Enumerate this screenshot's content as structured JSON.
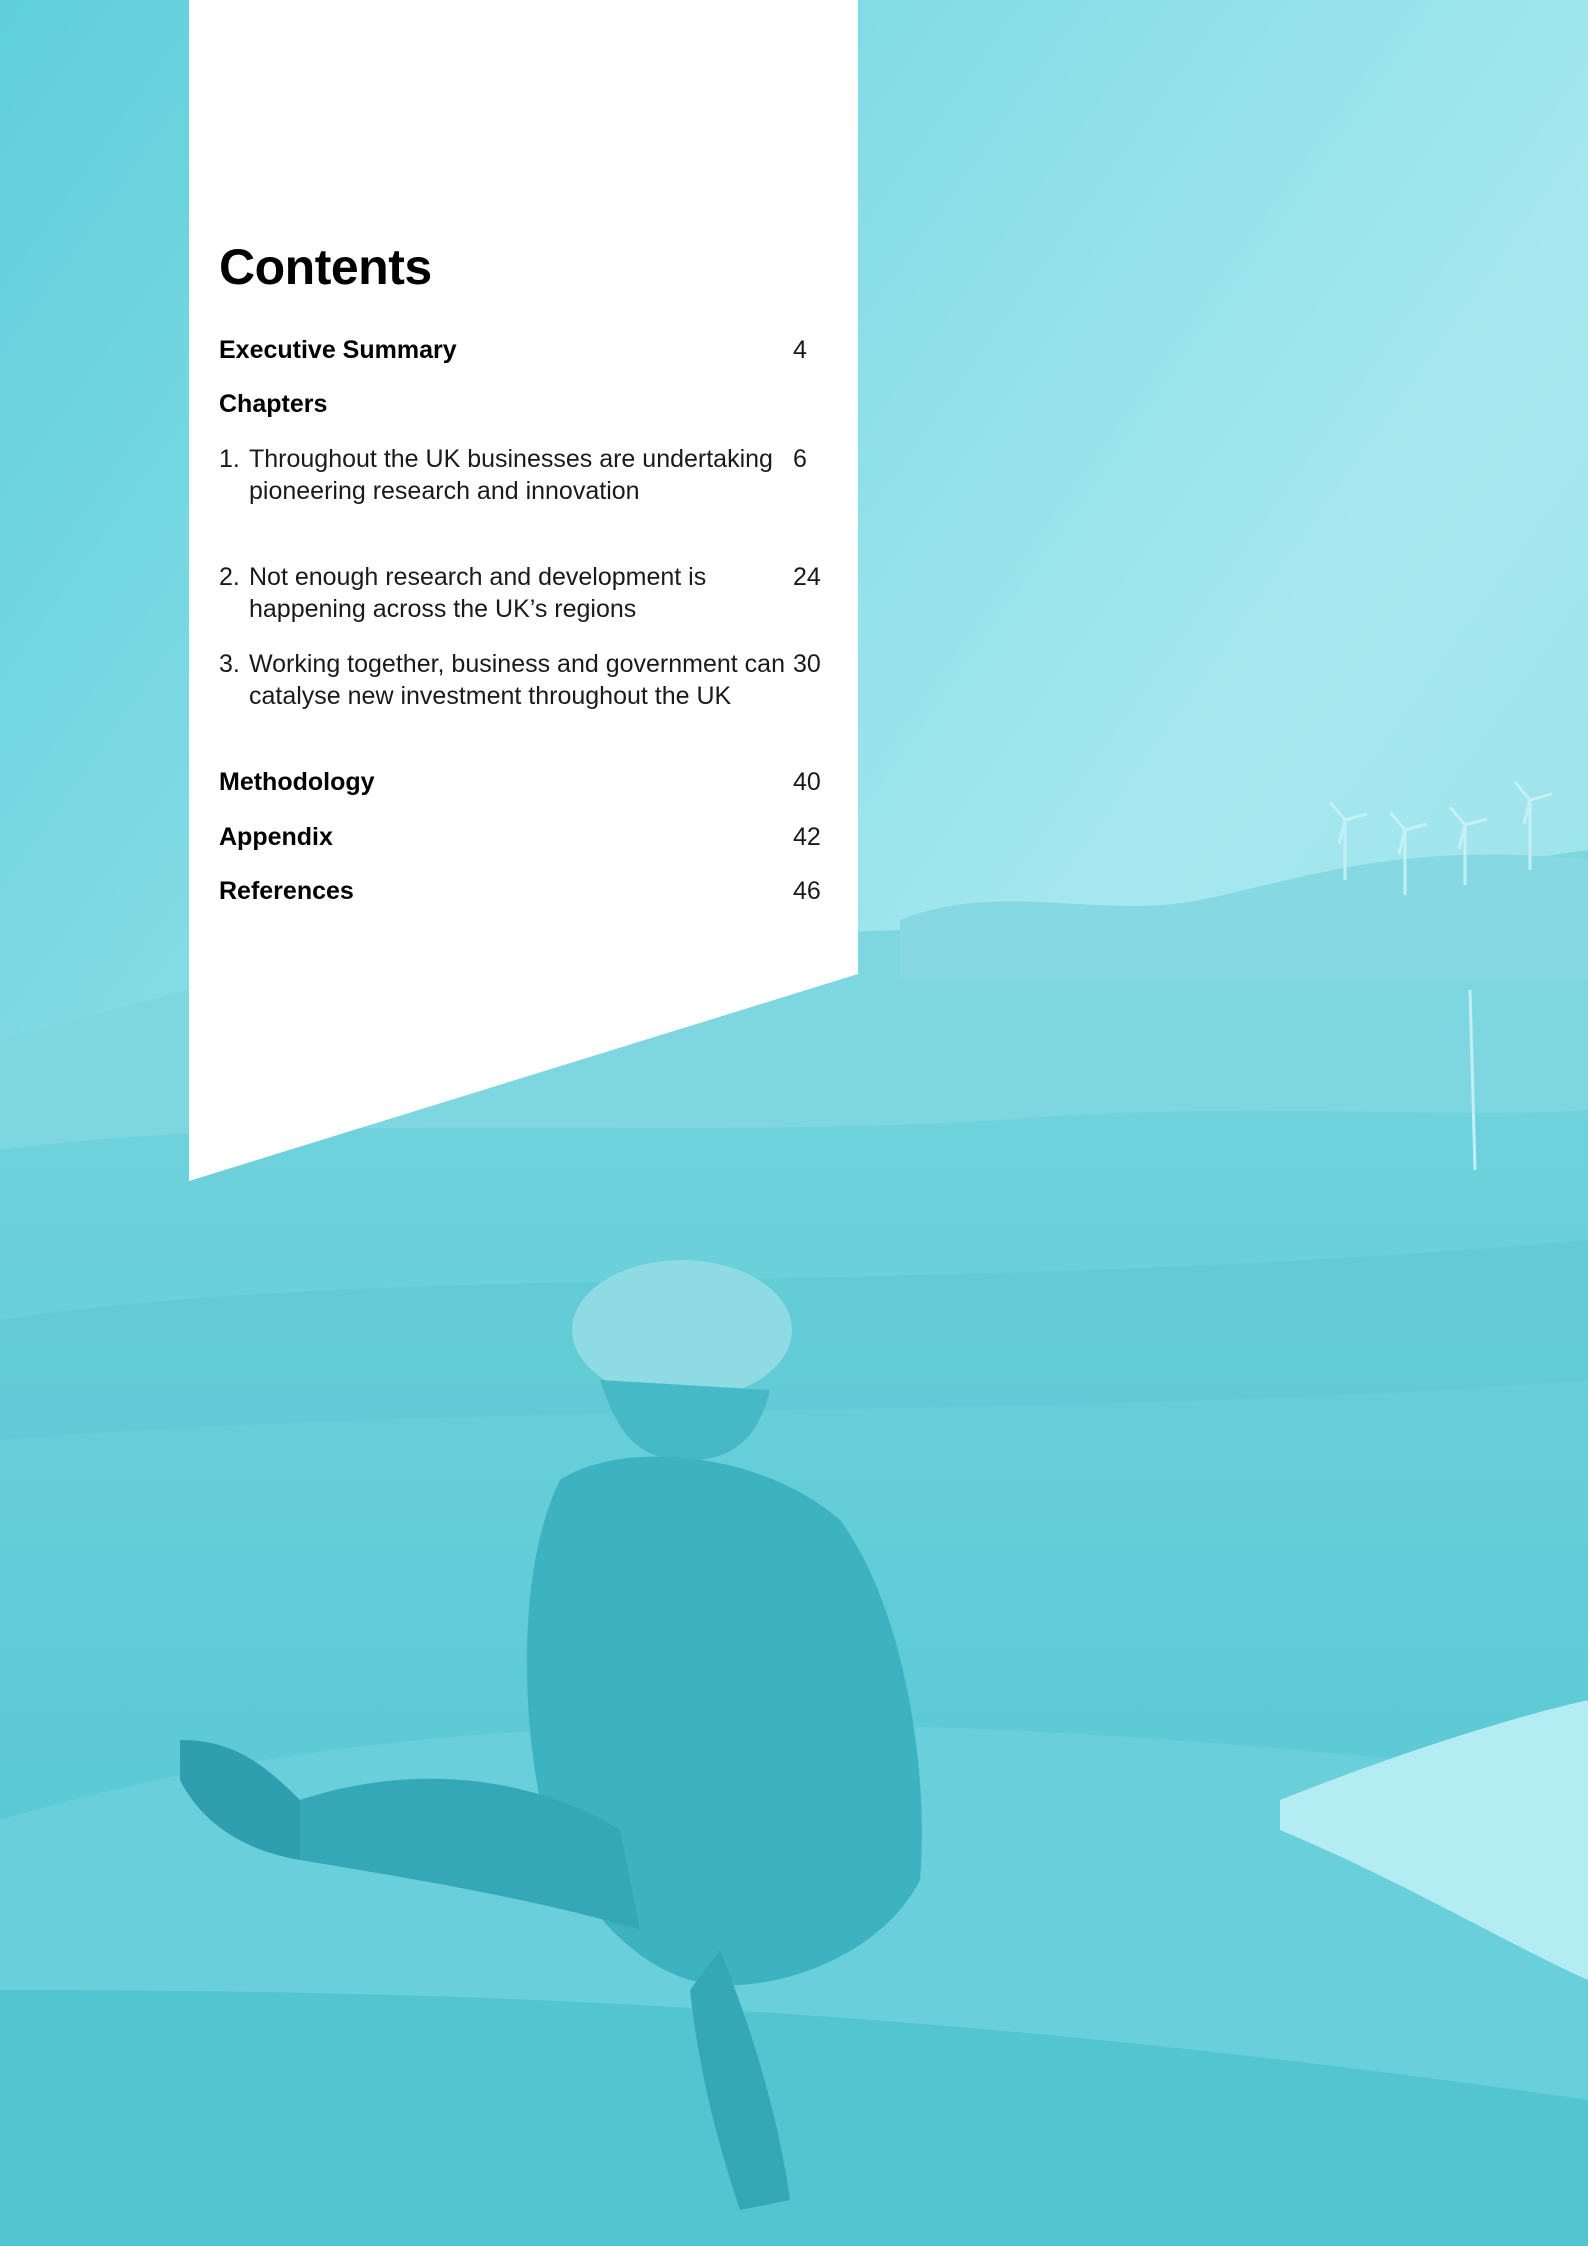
{
  "contents": {
    "title": "Contents",
    "entries": [
      {
        "title": "Executive Summary",
        "page": "4"
      },
      {
        "title": "Chapters",
        "page": ""
      },
      {
        "num": "1.",
        "title": "Throughout the UK businesses are undertaking pioneering research and innovation",
        "page": "6"
      },
      {
        "num": "2.",
        "title": "Not enough research and development is happening across the UK’s regions",
        "page": "24"
      },
      {
        "num": "3.",
        "title": "Working together, business and government can catalyse new investment throughout the UK",
        "page": "30"
      },
      {
        "title": "Methodology",
        "page": "40"
      },
      {
        "title": "Appendix",
        "page": "42"
      },
      {
        "title": "References",
        "page": "46"
      }
    ]
  },
  "colors": {
    "overlay_tint": "#5cccd8",
    "panel": "#ffffff",
    "text": "#000000"
  },
  "image": {
    "description_icon": "wind-turbine-technician-photo"
  }
}
